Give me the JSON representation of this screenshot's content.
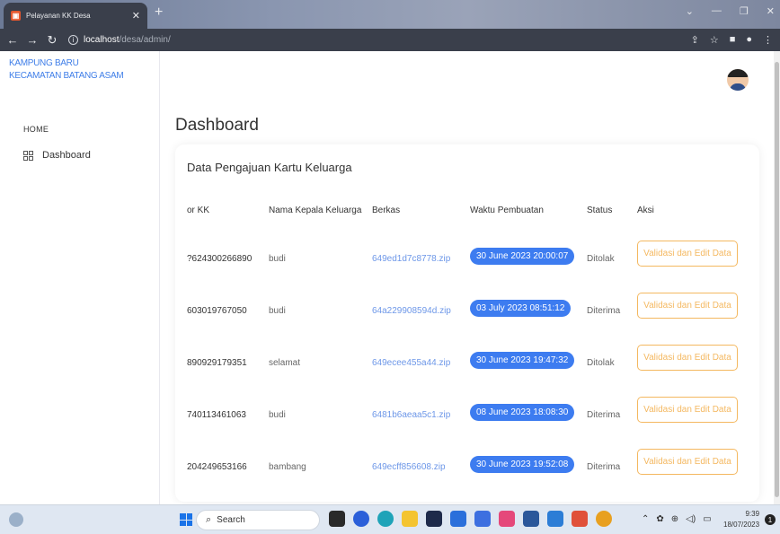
{
  "browser": {
    "tab_title": "Pelayanan KK Desa",
    "url_host": "localhost",
    "url_path": "/desa/admin/"
  },
  "sidebar": {
    "brand_line1": "KAMPUNG BARU",
    "brand_line2": "KECAMATAN BATANG ASAM",
    "section": "HOME",
    "items": [
      {
        "label": "Dashboard"
      }
    ]
  },
  "main": {
    "title": "Dashboard",
    "card_title": "Data Pengajuan Kartu Keluarga",
    "columns": [
      "or KK",
      "Nama Kepala Keluarga",
      "Berkas",
      "Waktu Pembuatan",
      "Status",
      "Aksi"
    ],
    "rows": [
      {
        "no_kk": "?624300266890",
        "nama": "budi",
        "berkas": "649ed1d7c8778.zip",
        "waktu": "30 June 2023 20:00:07",
        "status": "Ditolak",
        "aksi": "Validasi dan Edit Data"
      },
      {
        "no_kk": "603019767050",
        "nama": "budi",
        "berkas": "64a229908594d.zip",
        "waktu": "03 July 2023 08:51:12",
        "status": "Diterima",
        "aksi": "Validasi dan Edit Data"
      },
      {
        "no_kk": "890929179351",
        "nama": "selamat",
        "berkas": "649ecee455a44.zip",
        "waktu": "30 June 2023 19:47:32",
        "status": "Ditolak",
        "aksi": "Validasi dan Edit Data"
      },
      {
        "no_kk": "740113461063",
        "nama": "budi",
        "berkas": "6481b6aeaa5c1.zip",
        "waktu": "08 June 2023 18:08:30",
        "status": "Diterima",
        "aksi": "Validasi dan Edit Data"
      },
      {
        "no_kk": "204249653166",
        "nama": "bambang",
        "berkas": "649ecff856608.zip",
        "waktu": "30 June 2023 19:52:08",
        "status": "Diterima",
        "aksi": "Validasi dan Edit Data"
      }
    ]
  },
  "taskbar": {
    "search_placeholder": "Search",
    "time": "9:39",
    "date": "18/07/2023"
  },
  "colors": {
    "accent": "#3d7cf0",
    "link": "#6d97e8",
    "action": "#f4b860",
    "brand": "#3f7ee8"
  }
}
